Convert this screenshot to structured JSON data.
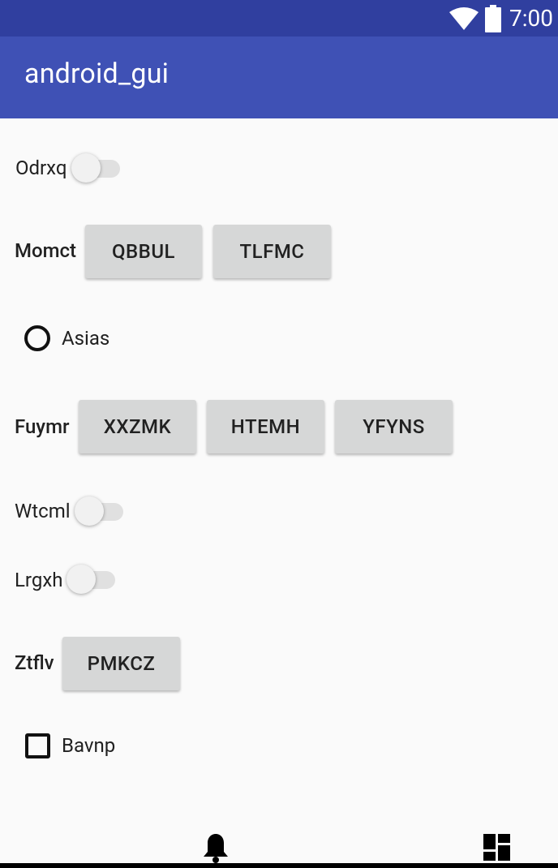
{
  "status_bar": {
    "time": "7:00",
    "icons": [
      "wifi-icon",
      "battery-icon"
    ]
  },
  "app_bar": {
    "title": "android_gui"
  },
  "rows": {
    "odrxq": {
      "label": "Odrxq",
      "switch_on": false
    },
    "momct": {
      "label": "Momct",
      "buttons": [
        "QBBUL",
        "TLFMC"
      ]
    },
    "asias": {
      "label": "Asias",
      "checked": false
    },
    "fuymr": {
      "label": "Fuymr",
      "buttons": [
        "XXZMK",
        "HTEMH",
        "YFYNS"
      ]
    },
    "wtcml": {
      "label": "Wtcml",
      "switch_on": false
    },
    "lrgxh": {
      "label": "Lrgxh",
      "switch_on": false
    },
    "ztflv": {
      "label": "Ztflv",
      "buttons": [
        "PMKCZ"
      ]
    },
    "bavnp": {
      "label": "Bavnp",
      "checked": false
    }
  },
  "bottom_nav": {
    "icons": [
      "bell-icon",
      "dashboard-icon"
    ]
  }
}
